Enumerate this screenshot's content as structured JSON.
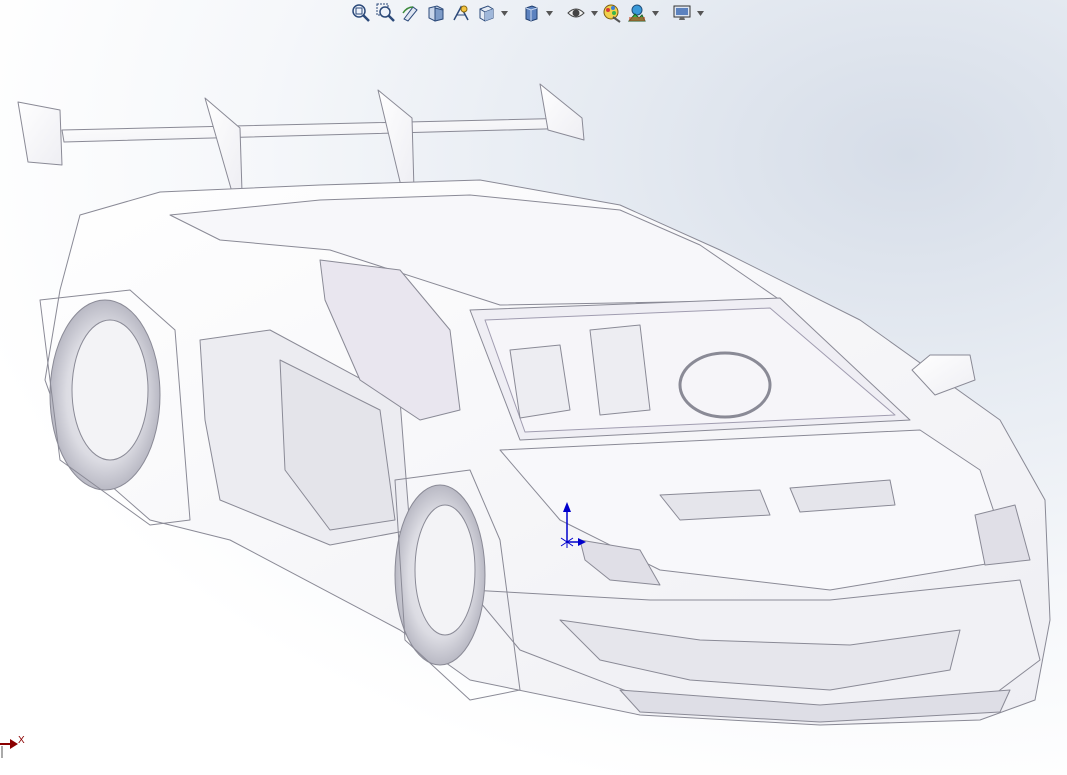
{
  "window": {
    "background_accent": "#d6dde8"
  },
  "toolbar": {
    "buttons": [
      {
        "name": "zoom-to-fit-icon",
        "dropdown": false
      },
      {
        "name": "zoom-to-area-icon",
        "dropdown": false
      },
      {
        "name": "previous-view-icon",
        "dropdown": false
      },
      {
        "name": "section-view-icon",
        "dropdown": false
      },
      {
        "name": "dynamic-annotation-icon",
        "dropdown": false
      },
      {
        "name": "view-orientation-icon",
        "dropdown": true
      },
      {
        "name": "display-style-icon",
        "dropdown": true
      },
      {
        "name": "hide-show-items-icon",
        "dropdown": true
      },
      {
        "name": "edit-appearance-icon",
        "dropdown": false
      },
      {
        "name": "apply-scene-icon",
        "dropdown": true
      },
      {
        "name": "view-settings-icon",
        "dropdown": true
      }
    ]
  },
  "triad": {
    "x_label": "X",
    "x_color": "#8b0000"
  },
  "origin": {
    "color": "#0000cc"
  }
}
